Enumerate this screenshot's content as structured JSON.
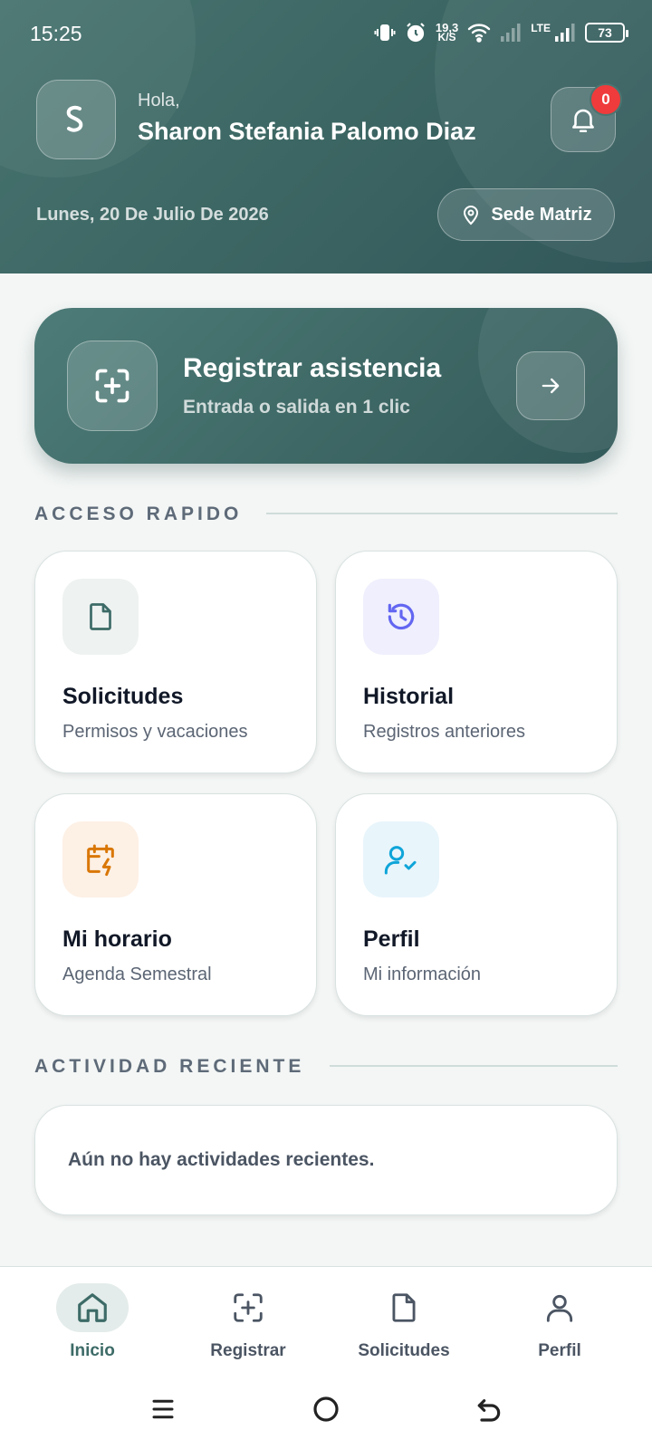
{
  "status_bar": {
    "time": "15:25",
    "speed_value": "19,3",
    "speed_unit": "K/S",
    "network": "LTE",
    "battery": "73"
  },
  "header": {
    "greeting": "Hola,",
    "user_name": "Sharon Stefania Palomo Diaz",
    "notifications_count": "0",
    "date": "Lunes, 20 De Julio De 2026",
    "location_label": "Sede Matriz"
  },
  "cta": {
    "title": "Registrar asistencia",
    "subtitle": "Entrada o salida en 1 clic"
  },
  "quick_access": {
    "heading": "ACCESO RAPIDO",
    "cards": [
      {
        "title": "Solicitudes",
        "subtitle": "Permisos y vacaciones",
        "icon": "document-icon",
        "color": "#3d6b67",
        "bg": "#eef2f1"
      },
      {
        "title": "Historial",
        "subtitle": "Registros anteriores",
        "icon": "history-icon",
        "color": "#6366f1",
        "bg": "#efeffd"
      },
      {
        "title": "Mi horario",
        "subtitle": "Agenda Semestral",
        "icon": "calendar-bolt-icon",
        "color": "#d97706",
        "bg": "#fdf0e5"
      },
      {
        "title": "Perfil",
        "subtitle": "Mi información",
        "icon": "user-check-icon",
        "color": "#0ea5d9",
        "bg": "#e8f5fb"
      }
    ]
  },
  "recent_activity": {
    "heading": "ACTIVIDAD RECIENTE",
    "empty_message": "Aún no hay actividades recientes."
  },
  "bottom_nav": {
    "items": [
      {
        "label": "Inicio",
        "icon": "home-icon",
        "active": true
      },
      {
        "label": "Registrar",
        "icon": "scan-plus-icon",
        "active": false
      },
      {
        "label": "Solicitudes",
        "icon": "document-icon",
        "active": false
      },
      {
        "label": "Perfil",
        "icon": "user-icon",
        "active": false
      }
    ]
  },
  "colors": {
    "brand": "#3d6b67",
    "badge": "#ef3b3b",
    "background": "#f3f6f5"
  }
}
